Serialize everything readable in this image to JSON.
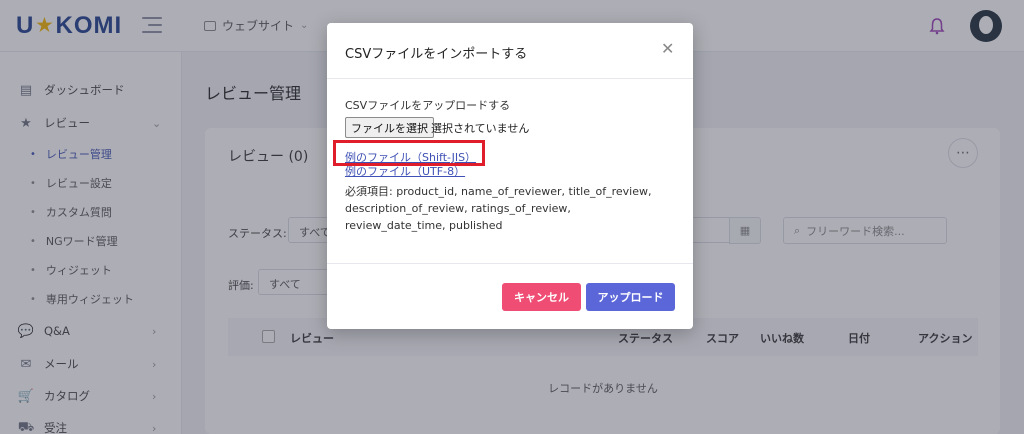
{
  "header": {
    "logo_left": "U",
    "logo_right": "KOMI",
    "site_select": "ウェブサイト"
  },
  "sidebar": {
    "items": [
      {
        "label": "ダッシュボード"
      },
      {
        "label": "レビュー"
      },
      {
        "label": "Q&A"
      },
      {
        "label": "メール"
      },
      {
        "label": "カタログ"
      },
      {
        "label": "受注"
      }
    ],
    "subitems": [
      {
        "label": "レビュー管理",
        "active": true
      },
      {
        "label": "レビュー設定"
      },
      {
        "label": "カスタム質問"
      },
      {
        "label": "NGワード管理"
      },
      {
        "label": "ウィジェット"
      },
      {
        "label": "専用ウィジェット"
      }
    ]
  },
  "main": {
    "page_title": "レビュー管理",
    "card_title": "レビュー (0)",
    "status_label": "ステータス:",
    "status_value": "すべて",
    "rating_label": "評価:",
    "rating_value": "すべて",
    "search_placeholder": "フリーワード検索...",
    "table_headers": [
      "レビュー",
      "ステータス",
      "スコア",
      "いいね数",
      "日付",
      "アクション"
    ],
    "empty_message": "レコードがありません"
  },
  "modal": {
    "title": "CSVファイルをインポートする",
    "upload_label": "CSVファイルをアップロードする",
    "file_button": "ファイルを選択",
    "file_status": "選択されていません",
    "link_shift_jis": "例のファイル（Shift-JIS）",
    "link_utf8": "例のファイル（UTF-8）",
    "required_fields": "必須項目: product_id, name_of_reviewer, title_of_review, description_of_review, ratings_of_review, review_date_time, published",
    "cancel_label": "キャンセル",
    "upload_button_label": "アップロード"
  },
  "colors": {
    "accent": "#5b67d8",
    "cancel": "#ef4d74",
    "highlight": "#e01e2b",
    "brand": "#1f3f8f"
  }
}
